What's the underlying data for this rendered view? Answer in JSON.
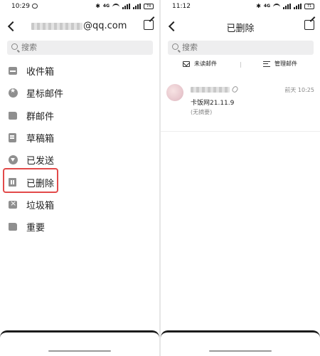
{
  "left": {
    "status": {
      "time": "10:29",
      "net": "4G",
      "battery": "74"
    },
    "header": {
      "account_suffix": "@qq.com"
    },
    "search": {
      "placeholder": "搜索"
    },
    "folders": [
      {
        "label": "收件箱",
        "icon": "inbox-icon"
      },
      {
        "label": "星标邮件",
        "icon": "star-icon"
      },
      {
        "label": "群邮件",
        "icon": "folder-icon"
      },
      {
        "label": "草稿箱",
        "icon": "draft-icon"
      },
      {
        "label": "已发送",
        "icon": "sent-icon"
      },
      {
        "label": "已删除",
        "icon": "trash-icon"
      },
      {
        "label": "垃圾箱",
        "icon": "junk-icon"
      },
      {
        "label": "重要",
        "icon": "folder-icon"
      }
    ],
    "highlight_color": "#e24a4a"
  },
  "right": {
    "status": {
      "time": "11:12",
      "net": "4G",
      "battery": "71"
    },
    "header": {
      "title": "已删除"
    },
    "search": {
      "placeholder": "搜索"
    },
    "toolbar": {
      "unread": "未读邮件",
      "manage": "管理邮件"
    },
    "mail": {
      "time": "前天 10:25",
      "subject": "卡饭网21.11.9",
      "summary": "(无摘要)"
    }
  }
}
